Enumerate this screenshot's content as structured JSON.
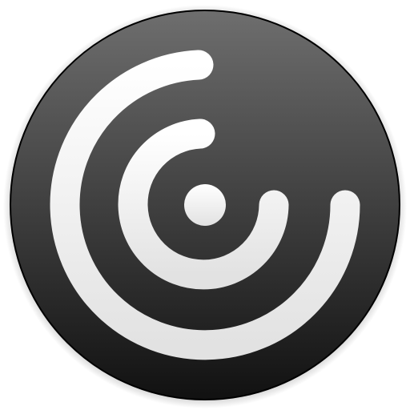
{
  "icon": {
    "name": "radar-signal-icon",
    "colors": {
      "disc_top": "#6e6e6e",
      "disc_bottom": "#111111",
      "rim": "#000000",
      "arc_top": "#ffffff",
      "arc_bottom": "#e2e2e2"
    }
  }
}
